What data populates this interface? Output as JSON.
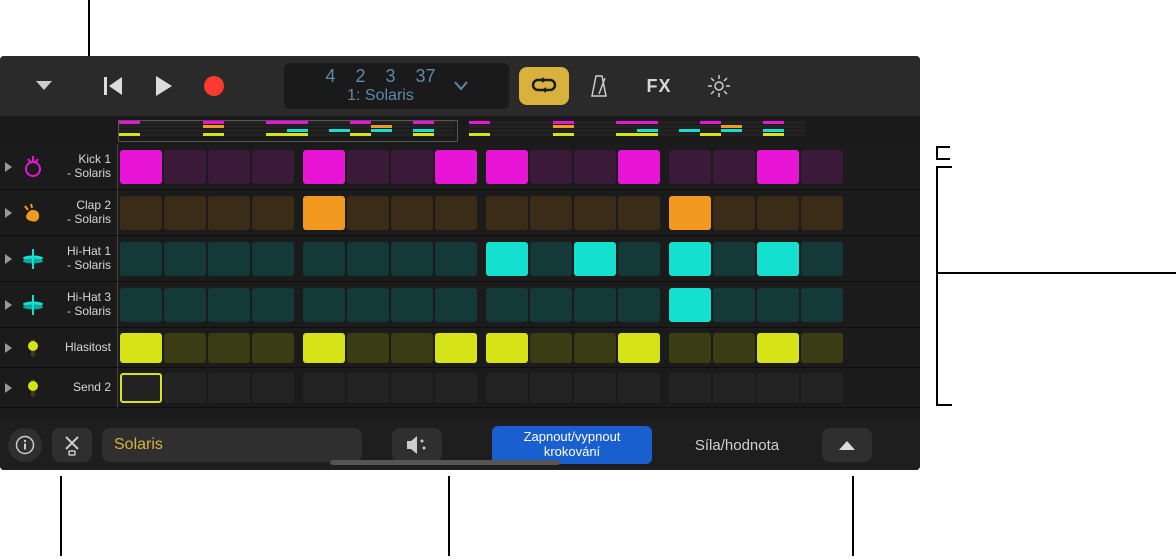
{
  "toolbar": {
    "time_sig": [
      "4",
      "2",
      "3",
      "37"
    ],
    "section": "1: Solaris",
    "fx_label": "FX"
  },
  "tracks": [
    {
      "name_line1": "Kick 1",
      "name_line2": "- Solaris",
      "icon": "kick",
      "color": "magenta",
      "steps": [
        1,
        0,
        0,
        0,
        1,
        0,
        0,
        1,
        1,
        0,
        0,
        1,
        0,
        0,
        1,
        0
      ]
    },
    {
      "name_line1": "Clap 2",
      "name_line2": "- Solaris",
      "icon": "clap",
      "color": "orange",
      "steps": [
        0,
        0,
        0,
        0,
        1,
        0,
        0,
        0,
        0,
        0,
        0,
        0,
        1,
        0,
        0,
        0
      ]
    },
    {
      "name_line1": "Hi-Hat 1",
      "name_line2": "- Solaris",
      "icon": "hat",
      "color": "cyan",
      "steps": [
        0,
        0,
        0,
        0,
        0,
        0,
        0,
        0,
        1,
        0,
        1,
        0,
        1,
        0,
        1,
        0
      ]
    },
    {
      "name_line1": "Hi-Hat 3",
      "name_line2": "- Solaris",
      "icon": "hat",
      "color": "cyan",
      "steps": [
        0,
        0,
        0,
        0,
        0,
        0,
        0,
        0,
        0,
        0,
        0,
        0,
        1,
        0,
        0,
        0
      ]
    },
    {
      "name_line1": "Hlasitost",
      "name_line2": "",
      "icon": "vol",
      "color": "yell",
      "steps": [
        1,
        0,
        0,
        0,
        1,
        0,
        0,
        1,
        1,
        0,
        0,
        1,
        0,
        0,
        1,
        0
      ]
    },
    {
      "name_line1": "Send 2",
      "name_line2": "",
      "icon": "vol",
      "color": "yell-outline",
      "steps": [
        2,
        0,
        0,
        0,
        0,
        0,
        0,
        0,
        0,
        0,
        0,
        0,
        0,
        0,
        0,
        0
      ]
    }
  ],
  "bottom": {
    "preset_name": "Solaris",
    "toggle_line1": "Zapnout/vypnout",
    "toggle_line2": "krokování",
    "velocity_label": "Síla/hodnota"
  }
}
